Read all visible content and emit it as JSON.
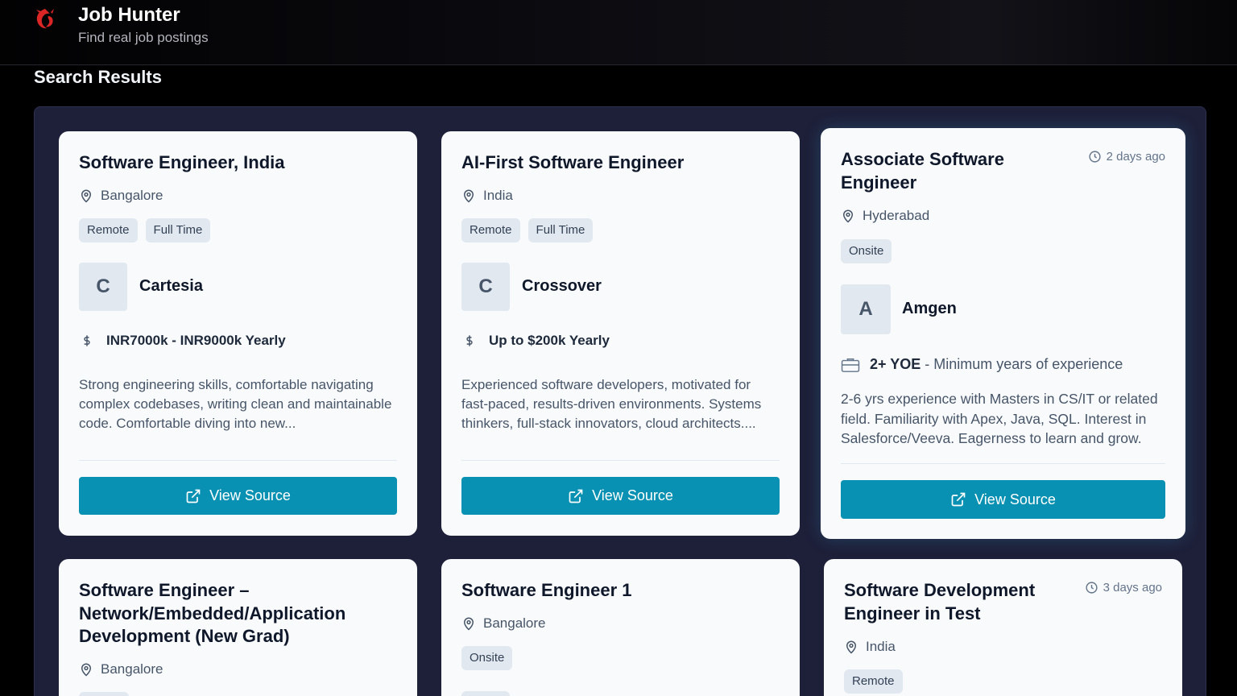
{
  "app": {
    "title": "Job Hunter",
    "subtitle": "Find real job postings",
    "logo_icon": "dragon-logo-icon"
  },
  "section_title": "Search Results",
  "colors": {
    "page_bg": "#000000",
    "panel_bg": "#1e1f38",
    "card_bg": "#f8fafc",
    "button": "#0891b2",
    "tag_bg": "#e2e8f0",
    "logo": "#dc2626"
  },
  "jobs": [
    {
      "title": "Software Engineer, India",
      "location": "Bangalore",
      "tags": [
        "Remote",
        "Full Time"
      ],
      "company_initial": "C",
      "company": "Cartesia",
      "salary": "INR7000k - INR9000k Yearly",
      "description": "Strong engineering skills, comfortable navigating complex codebases, writing clean and maintainable code. Comfortable diving into new...",
      "button_label": "View Source"
    },
    {
      "title": "AI-First Software Engineer",
      "location": "India",
      "tags": [
        "Remote",
        "Full Time"
      ],
      "company_initial": "C",
      "company": "Crossover",
      "salary": "Up to $200k Yearly",
      "description": "Experienced software developers, motivated for fast-paced, results-driven environments. Systems thinkers, full-stack innovators, cloud architects....",
      "button_label": "View Source"
    },
    {
      "title": "Associate Software Engineer",
      "posted": "2 days ago",
      "location": "Hyderabad",
      "tags": [
        "Onsite"
      ],
      "company_initial": "A",
      "company": "Amgen",
      "experience_value": "2+ YOE",
      "experience_label": "- Minimum years of experience",
      "description": "2-6 yrs experience with Masters in CS/IT or related field. Familiarity with Apex, Java, SQL. Interest in Salesforce/Veeva. Eagerness to learn and grow.",
      "button_label": "View Source"
    },
    {
      "title": "Software Engineer – Network/Embedded/Application Development (New Grad)",
      "location": "Bangalore"
    },
    {
      "title": "Software Engineer 1",
      "location": "Bangalore",
      "tags": [
        "Onsite"
      ]
    },
    {
      "title": "Software Development Engineer in Test",
      "posted": "3 days ago",
      "location": "India",
      "tags": [
        "Remote"
      ]
    }
  ]
}
